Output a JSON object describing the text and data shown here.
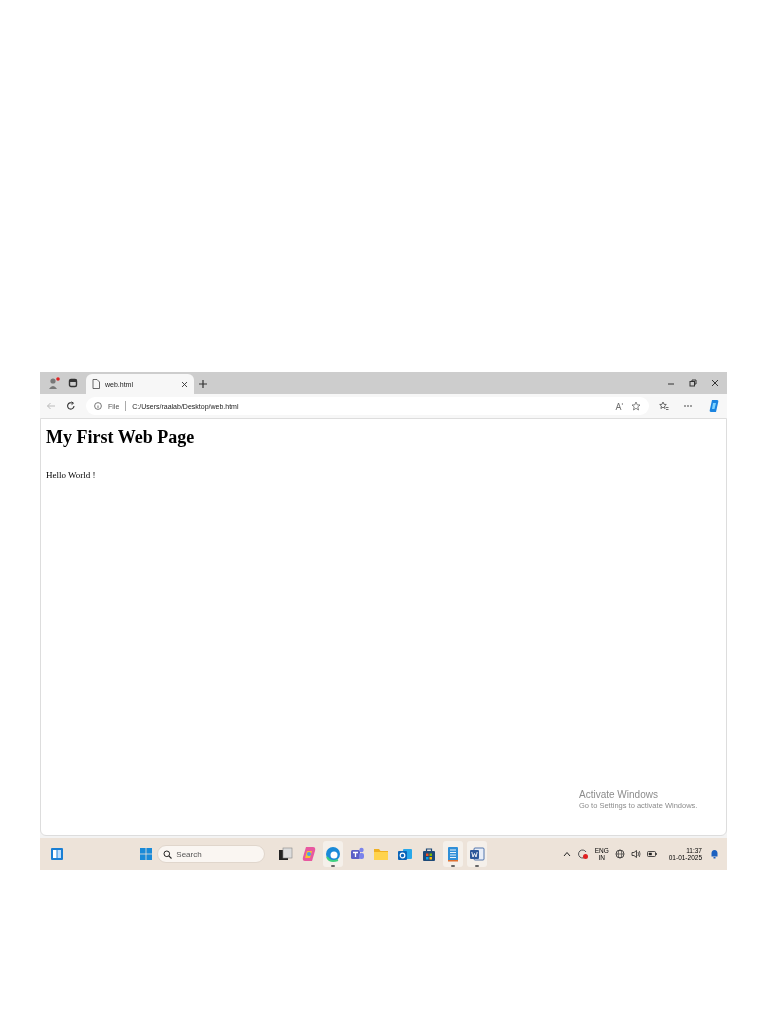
{
  "browser": {
    "tabs": [
      {
        "title": "web.html",
        "selected": true
      }
    ],
    "address": {
      "scheme": "File",
      "url": "C:/Users/raalab/Desktop/web.html"
    }
  },
  "page": {
    "heading": "My First Web Page",
    "paragraph": "Hello World !"
  },
  "watermark": {
    "title": "Activate Windows",
    "subtitle": "Go to Settings to activate Windows."
  },
  "taskbar": {
    "search_placeholder": "Search",
    "apps": [
      {
        "kind": "taskview",
        "open": false
      },
      {
        "kind": "copilot",
        "open": false
      },
      {
        "kind": "edge",
        "open": true
      },
      {
        "kind": "teams",
        "open": false
      },
      {
        "kind": "folder",
        "open": false
      },
      {
        "kind": "outlook",
        "open": false
      },
      {
        "kind": "store",
        "open": false
      },
      {
        "kind": "notepad",
        "open": true
      },
      {
        "kind": "word",
        "open": true
      }
    ],
    "language": "ENG",
    "region": "IN",
    "time": "11:37",
    "date": "01-01-2025"
  }
}
